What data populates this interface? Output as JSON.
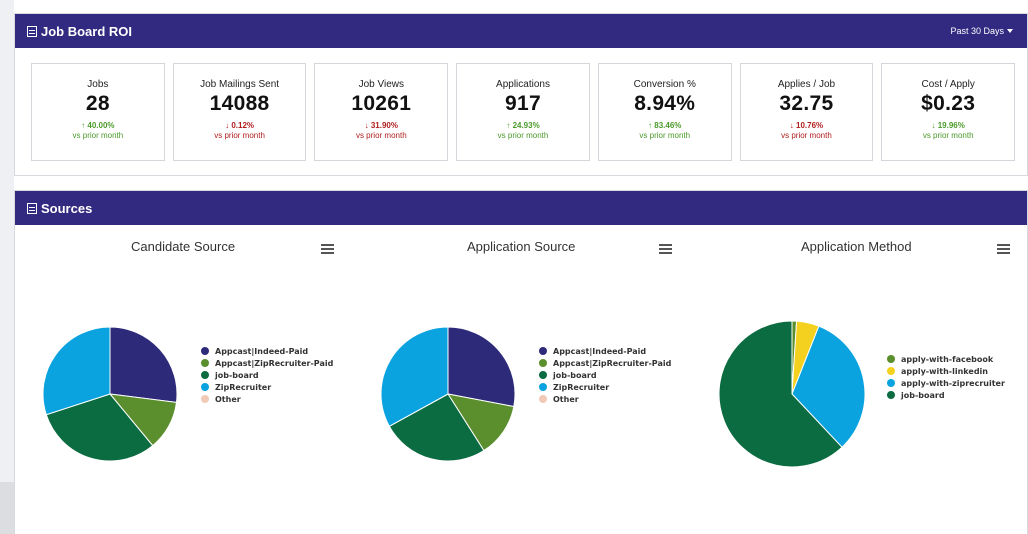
{
  "roi": {
    "title": "Job Board ROI",
    "range_label": "Past 30 Days",
    "kpis": [
      {
        "label": "Jobs",
        "value": "28",
        "change": "40.00%",
        "dir": "up",
        "sub": "vs prior month"
      },
      {
        "label": "Job Mailings Sent",
        "value": "14088",
        "change": "0.12%",
        "dir": "down",
        "sub": "vs prior month"
      },
      {
        "label": "Job Views",
        "value": "10261",
        "change": "31.90%",
        "dir": "down",
        "sub": "vs prior month"
      },
      {
        "label": "Applications",
        "value": "917",
        "change": "24.93%",
        "dir": "up",
        "sub": "vs prior month"
      },
      {
        "label": "Conversion %",
        "value": "8.94%",
        "change": "83.46%",
        "dir": "up",
        "sub": "vs prior month"
      },
      {
        "label": "Applies / Job",
        "value": "32.75",
        "change": "10.76%",
        "dir": "down",
        "sub": "vs prior month"
      },
      {
        "label": "Cost / Apply",
        "value": "$0.23",
        "change": "19.96%",
        "dir": "down-good",
        "sub": "vs prior month"
      }
    ]
  },
  "sources": {
    "title": "Sources"
  },
  "chart_data": [
    {
      "type": "pie",
      "title": "Candidate Source",
      "series": [
        {
          "name": "Appcast|Indeed-Paid",
          "value": 27,
          "color": "#2e2a7a"
        },
        {
          "name": "Appcast|ZipRecruiter-Paid",
          "value": 12,
          "color": "#5b8e2d"
        },
        {
          "name": "job-board",
          "value": 31,
          "color": "#0b6b41"
        },
        {
          "name": "ZipRecruiter",
          "value": 30,
          "color": "#0aa3df"
        },
        {
          "name": "Other",
          "value": 0,
          "color": "#f1c9b5"
        }
      ]
    },
    {
      "type": "pie",
      "title": "Application Source",
      "series": [
        {
          "name": "Appcast|Indeed-Paid",
          "value": 28,
          "color": "#2e2a7a"
        },
        {
          "name": "Appcast|ZipRecruiter-Paid",
          "value": 13,
          "color": "#5b8e2d"
        },
        {
          "name": "job-board",
          "value": 26,
          "color": "#0b6b41"
        },
        {
          "name": "ZipRecruiter",
          "value": 33,
          "color": "#0aa3df"
        },
        {
          "name": "Other",
          "value": 0,
          "color": "#f1c9b5"
        }
      ]
    },
    {
      "type": "pie",
      "title": "Application Method",
      "series": [
        {
          "name": "apply-with-facebook",
          "value": 1,
          "color": "#5b8e2d"
        },
        {
          "name": "apply-with-linkedin",
          "value": 5,
          "color": "#f5d11f"
        },
        {
          "name": "apply-with-ziprecruiter",
          "value": 32,
          "color": "#0aa3df"
        },
        {
          "name": "job-board",
          "value": 62,
          "color": "#0b6b41"
        }
      ]
    }
  ]
}
